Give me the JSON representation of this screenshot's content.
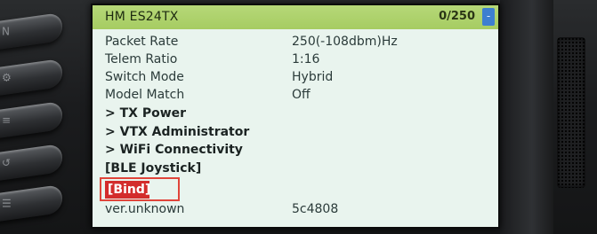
{
  "screen": {
    "title": "HM ES24TX",
    "counter": "0/250",
    "scroll_marker": "-"
  },
  "menu": [
    {
      "label": "Packet Rate",
      "value": "250(-108dbm)Hz"
    },
    {
      "label": "Telem Ratio",
      "value": "1:16"
    },
    {
      "label": "Switch Mode",
      "value": "Hybrid"
    },
    {
      "label": "Model Match",
      "value": "Off"
    },
    {
      "label": "> TX Power"
    },
    {
      "label": "> VTX Administrator"
    },
    {
      "label": "> WiFi Connectivity"
    },
    {
      "label": "[BLE Joystick]"
    },
    {
      "label": "[Bind]"
    },
    {
      "label": "ver.unknown",
      "value": "5c4808"
    }
  ],
  "side_buttons": [
    "N",
    "⚙",
    "≡",
    "↺",
    "☰"
  ],
  "colors": {
    "titlebar": "#a6cc62",
    "screen_bg": "#e9f4ee",
    "selected_bg": "#d32c2c",
    "highlight_border": "#e0453a",
    "scroll_marker": "#3d7fd0"
  }
}
